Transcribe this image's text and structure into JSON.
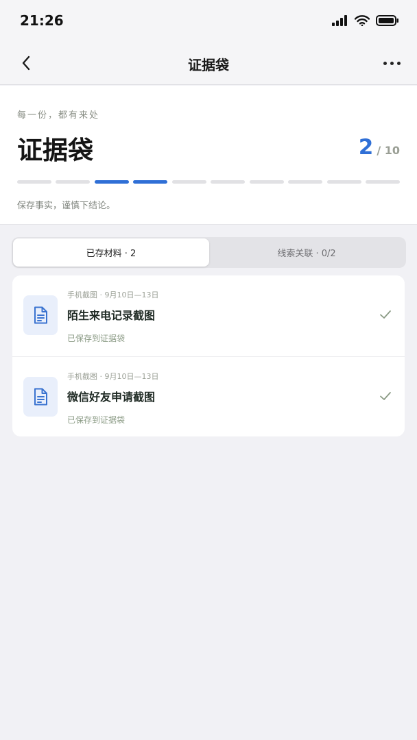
{
  "status_bar": {
    "time": "21:26"
  },
  "nav": {
    "title": "证据袋"
  },
  "header": {
    "tagline": "每一份，都有来处",
    "title": "证据袋",
    "count_current": "2",
    "count_total": "/ 10",
    "progress": {
      "total_segments": 10,
      "filled_segments": [
        3,
        4
      ]
    },
    "caption": "保存事实，谨慎下结论。"
  },
  "tabs": [
    {
      "label": "已存材料 · 2",
      "selected": true
    },
    {
      "label": "线索关联 · 0/2",
      "selected": false
    }
  ],
  "items": [
    {
      "meta": "手机截图 · 9月10日—13日",
      "title": "陌生来电记录截图",
      "status": "已保存到证据袋",
      "icon": "document-icon",
      "checked": true
    },
    {
      "meta": "手机截图 · 9月10日—13日",
      "title": "微信好友申请截图",
      "status": "已保存到证据袋",
      "icon": "document-icon",
      "checked": true
    }
  ],
  "colors": {
    "accent": "#2f6fd6",
    "muted_green": "#8a9a84",
    "icon_bg": "#e9effb"
  }
}
